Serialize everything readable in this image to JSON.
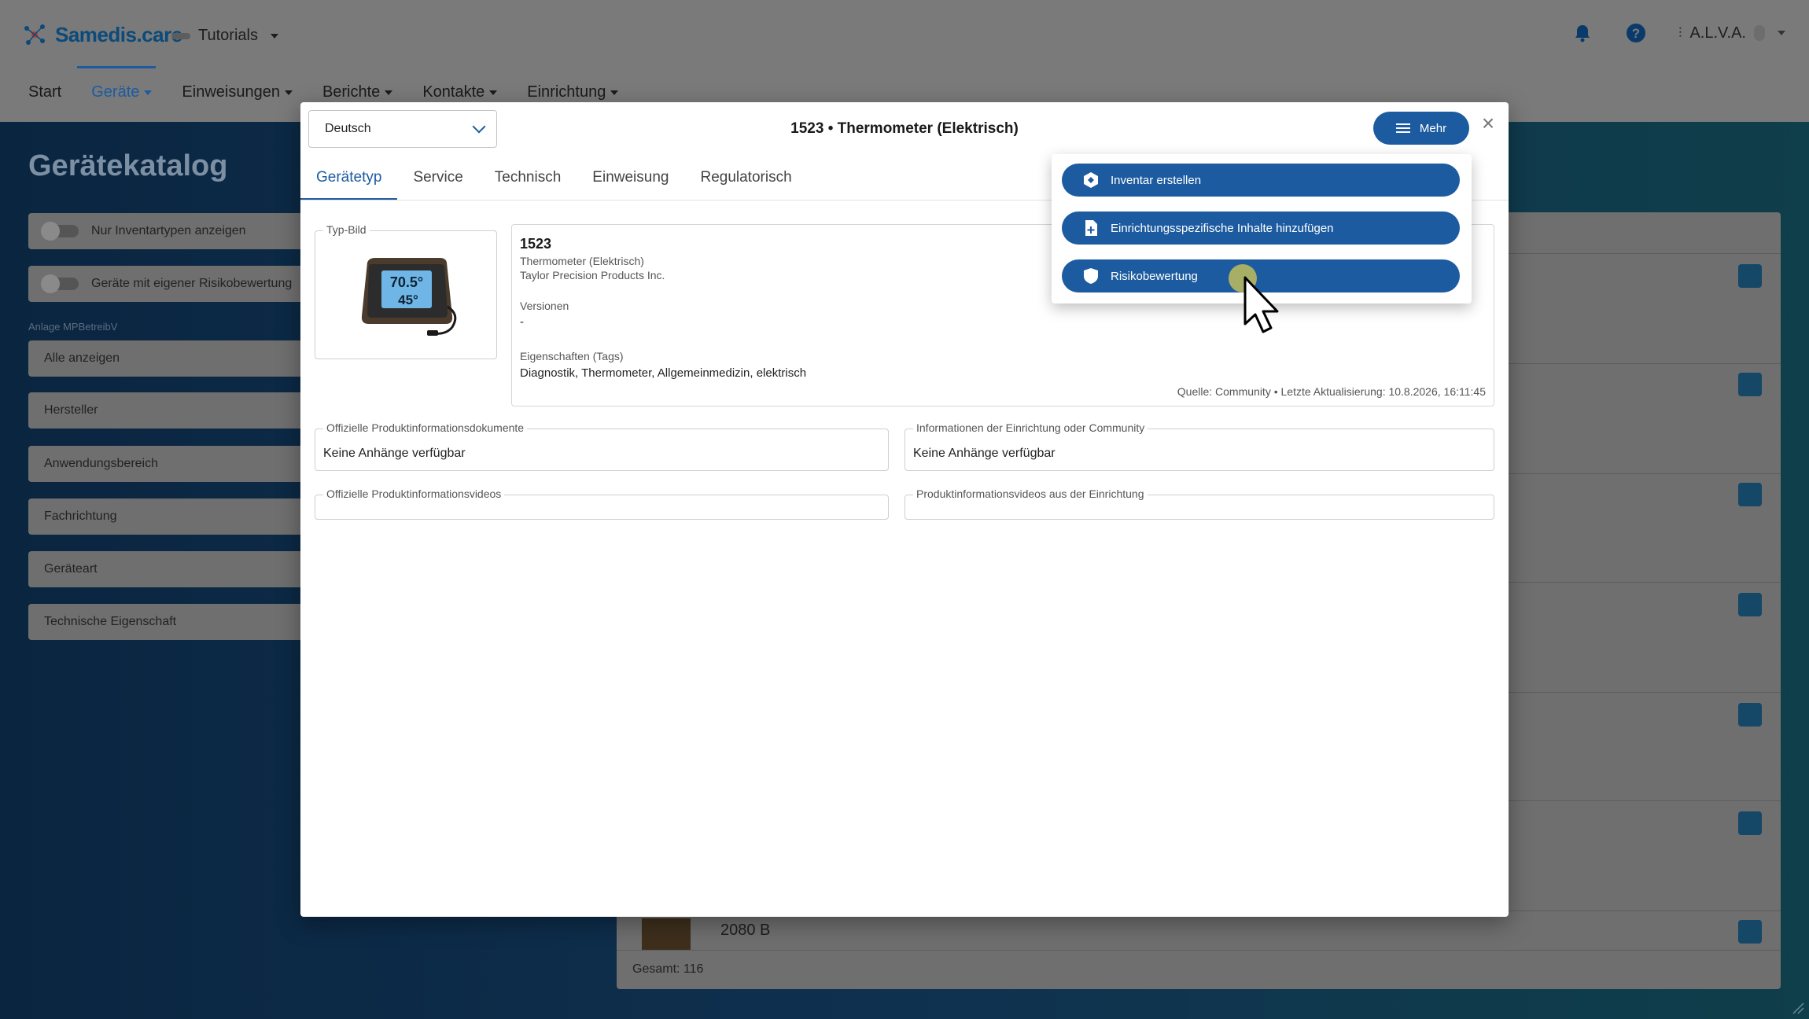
{
  "app": {
    "logo_text": "Samedis.care",
    "tenant": "Tutorials",
    "user": "A.L.V.A."
  },
  "nav": {
    "items": [
      "Start",
      "Geräte",
      "Einweisungen",
      "Berichte",
      "Kontakte",
      "Einrichtung"
    ]
  },
  "catalog": {
    "title": "Gerätekatalog",
    "toggles": [
      "Nur Inventartypen anzeigen",
      "Geräte mit eigener Risikobewertung"
    ],
    "filter_caption": "Anlage MPBetreibV",
    "filters": [
      "Alle anzeigen",
      "Hersteller",
      "Anwendungsbereich",
      "Fachrichtung",
      "Geräteart",
      "Technische Eigenschaft"
    ],
    "last_item_name": "2080 B",
    "total": "Gesamt: 116"
  },
  "modal": {
    "language": "Deutsch",
    "title": "1523 • Thermometer (Elektrisch)",
    "more_label": "Mehr",
    "tabs": [
      "Gerätetyp",
      "Service",
      "Technisch",
      "Einweisung",
      "Regulatorisch"
    ],
    "type_image_label": "Typ-Bild",
    "device": {
      "id": "1523",
      "type": "Thermometer (Elektrisch)",
      "manufacturer": "Taylor Precision Products Inc.",
      "versions_label": "Versionen",
      "versions_value": "-",
      "tags_label": "Eigenschaften (Tags)",
      "tags_value": "Diagnostik, Thermometer, Allgemeinmedizin, elektrisch",
      "source": "Quelle: Community • Letzte Aktualisierung: 10.8.2026, 16:11:45"
    },
    "docs": {
      "official_docs_label": "Offizielle Produktinformationsdokumente",
      "official_docs_value": "Keine Anhänge verfügbar",
      "facility_docs_label": "Informationen der Einrichtung oder Community",
      "facility_docs_value": "Keine Anhänge verfügbar",
      "official_videos_label": "Offizielle Produktinformationsvideos",
      "facility_videos_label": "Produktinformationsvideos aus der Einrichtung"
    },
    "display": {
      "top": "70.5°",
      "bottom": "45°"
    }
  },
  "menu": {
    "items": [
      {
        "label": "Inventar erstellen",
        "icon": "inventory-icon"
      },
      {
        "label": "Einrichtungsspezifische Inhalte hinzufügen",
        "icon": "file-add-icon"
      },
      {
        "label": "Risikobewertung",
        "icon": "shield-icon"
      }
    ]
  },
  "colors": {
    "primary": "#1d5ba0",
    "overlay": "#7a7a7a"
  }
}
